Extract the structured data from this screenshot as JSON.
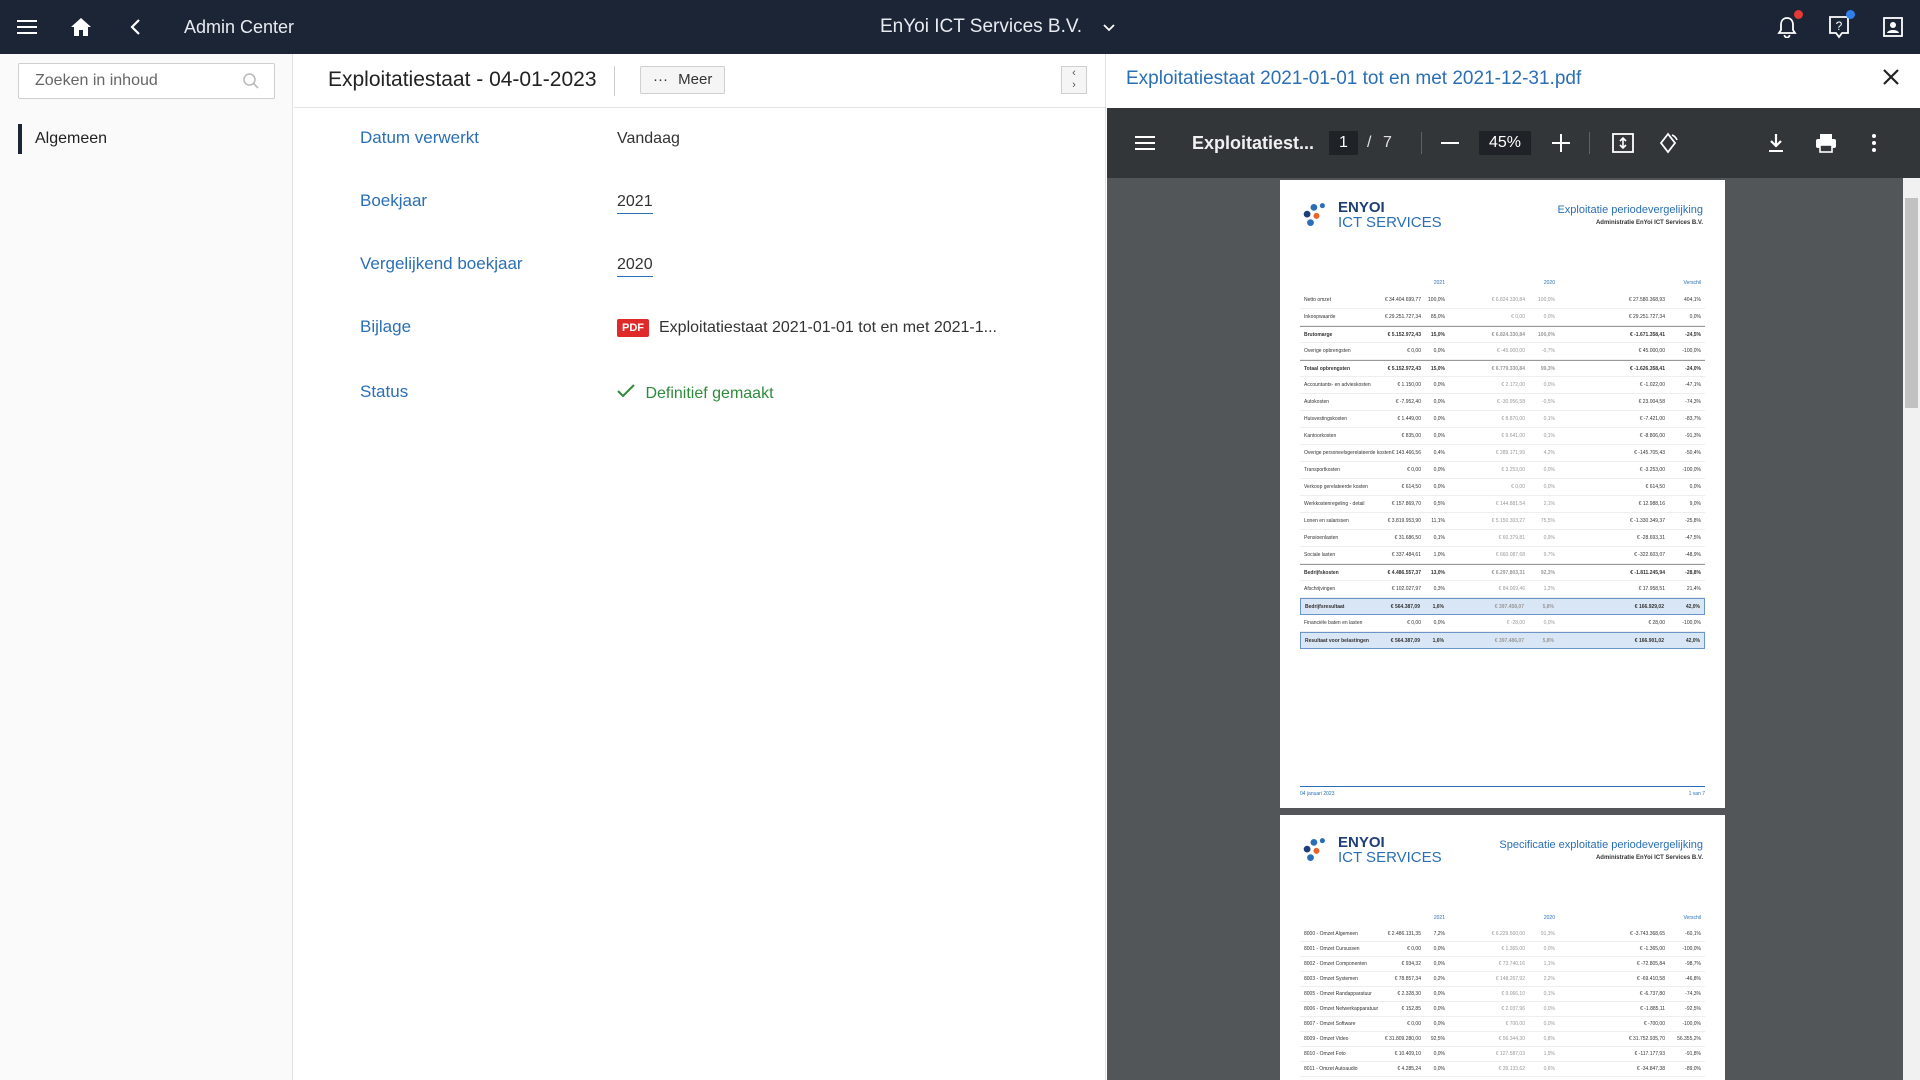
{
  "topbar": {
    "title": "Admin Center",
    "company": "EnYoi ICT Services B.V."
  },
  "sidebar": {
    "search_placeholder": "Zoeken in inhoud",
    "items": [
      {
        "label": "Algemeen"
      }
    ]
  },
  "detail": {
    "title": "Exploitatiestaat - 04-01-2023",
    "meer_label": "Meer",
    "fields": [
      {
        "label": "Datum verwerkt",
        "value": "Vandaag"
      },
      {
        "label": "Boekjaar",
        "value": "2021"
      },
      {
        "label": "Vergelijkend boekjaar",
        "value": "2020"
      },
      {
        "label": "Bijlage",
        "badge": "PDF",
        "value": "Exploitatiestaat 2021-01-01 tot en met 2021-1..."
      },
      {
        "label": "Status",
        "value": "Definitief gemaakt"
      }
    ]
  },
  "preview": {
    "title": "Exploitatiestaat 2021-01-01 tot en met 2021-12-31.pdf",
    "viewer": {
      "doc_title": "Exploitatiest...",
      "page_current": "1",
      "page_sep": "/",
      "page_total": "7",
      "zoom": "45%"
    },
    "page1": {
      "logo_line1": "ENYOI",
      "logo_line2": "ICT SERVICES",
      "heading": "Exploitatie periodevergelijking",
      "subheading": "Administratie EnYoi ICT Services B.V.",
      "col_headers": [
        "2021",
        "2020",
        "Verschil"
      ],
      "rows": [
        {
          "label": "Netto omzet",
          "v1": "€ 34.404.699,77",
          "p1": "100,0%",
          "v2": "€ 6.824.330,84",
          "p2": "100,0%",
          "v3": "€ 27.580.368,93",
          "p3": "404,1%",
          "style": ""
        },
        {
          "label": "Inkoopwaarde",
          "v1": "€ 29.251.727,34",
          "p1": "85,0%",
          "v2": "€ 0,00",
          "p2": "0,0%",
          "v3": "€ 29.251.727,34",
          "p3": "0,0%",
          "style": ""
        },
        {
          "label": "Brutomarge",
          "v1": "€ 5.152.972,43",
          "p1": "15,0%",
          "v2": "€ 6.824.330,84",
          "p2": "100,0%",
          "v3": "€ -1.671.358,41",
          "p3": "-24,5%",
          "style": "bold"
        },
        {
          "label": "Overige opbrengsten",
          "v1": "€ 0,00",
          "p1": "0,0%",
          "v2": "€ -45.000,00",
          "p2": "-0,7%",
          "v3": "€ 45.000,00",
          "p3": "-100,0%",
          "style": ""
        },
        {
          "label": "Totaal opbrengsten",
          "v1": "€ 5.152.972,43",
          "p1": "15,0%",
          "v2": "€ 6.779.330,84",
          "p2": "99,3%",
          "v3": "€ -1.626.358,41",
          "p3": "-24,0%",
          "style": "bold"
        },
        {
          "label": "Accountants- en advieskosten",
          "v1": "€ 1.150,00",
          "p1": "0,0%",
          "v2": "€ 2.172,00",
          "p2": "0,0%",
          "v3": "€ -1.022,00",
          "p3": "-47,1%",
          "style": ""
        },
        {
          "label": "Autokosten",
          "v1": "€ -7.952,40",
          "p1": "0,0%",
          "v2": "€ -30.956,58",
          "p2": "-0,5%",
          "v3": "€ 23.004,58",
          "p3": "-74,3%",
          "style": ""
        },
        {
          "label": "Huisvestingskosten",
          "v1": "€ 1.449,00",
          "p1": "0,0%",
          "v2": "€ 8.870,00",
          "p2": "0,1%",
          "v3": "€ -7.421,00",
          "p3": "-83,7%",
          "style": ""
        },
        {
          "label": "Kantoorkosten",
          "v1": "€ 835,00",
          "p1": "0,0%",
          "v2": "€ 9.641,00",
          "p2": "0,1%",
          "v3": "€ -8.806,00",
          "p3": "-91,3%",
          "style": ""
        },
        {
          "label": "Overige personeelsgerelateerde kosten",
          "v1": "€ 143.466,56",
          "p1": "0,4%",
          "v2": "€ 289.171,99",
          "p2": "4,2%",
          "v3": "€ -145.705,43",
          "p3": "-50,4%",
          "style": ""
        },
        {
          "label": "Transportkosten",
          "v1": "€ 0,00",
          "p1": "0,0%",
          "v2": "€ 3.253,00",
          "p2": "0,0%",
          "v3": "€ -3.253,00",
          "p3": "-100,0%",
          "style": ""
        },
        {
          "label": "Verkoop gerelateerde kosten",
          "v1": "€ 614,50",
          "p1": "0,0%",
          "v2": "€ 0,00",
          "p2": "0,0%",
          "v3": "€ 614,50",
          "p3": "0,0%",
          "style": ""
        },
        {
          "label": "Werkkostenregeling - detail",
          "v1": "€ 157.869,70",
          "p1": "0,5%",
          "v2": "€ 144.881,54",
          "p2": "2,1%",
          "v3": "€ 12.988,16",
          "p3": "9,0%",
          "style": ""
        },
        {
          "label": "Lonen en salarissen",
          "v1": "€ 3.819.953,90",
          "p1": "11,1%",
          "v2": "€ 5.150.303,27",
          "p2": "75,5%",
          "v3": "€ -1.330.349,37",
          "p3": "-25,8%",
          "style": ""
        },
        {
          "label": "Pensioenlasten",
          "v1": "€ 31.686,50",
          "p1": "0,1%",
          "v2": "€ 60.379,81",
          "p2": "0,9%",
          "v3": "€ -28.693,31",
          "p3": "-47,5%",
          "style": ""
        },
        {
          "label": "Sociale lasten",
          "v1": "€ 337.484,61",
          "p1": "1,0%",
          "v2": "€ 660.087,68",
          "p2": "9,7%",
          "v3": "€ -322.603,07",
          "p3": "-48,9%",
          "style": ""
        },
        {
          "label": "Bedrijfskosten",
          "v1": "€ 4.486.557,37",
          "p1": "13,0%",
          "v2": "€ 6.297.803,31",
          "p2": "92,3%",
          "v3": "€ -1.811.245,94",
          "p3": "-28,8%",
          "style": "bold"
        },
        {
          "label": "Afschrijvingen",
          "v1": "€ 102.027,97",
          "p1": "0,3%",
          "v2": "€ 84.069,46",
          "p2": "1,2%",
          "v3": "€ 17.958,51",
          "p3": "21,4%",
          "style": ""
        },
        {
          "label": "Bedrijfsresultaat",
          "v1": "€ 564.387,09",
          "p1": "1,6%",
          "v2": "€ 397.458,07",
          "p2": "5,8%",
          "v3": "€ 166.929,02",
          "p3": "42,0%",
          "style": "hl"
        },
        {
          "label": "Financiële baten en lasten",
          "v1": "€ 0,00",
          "p1": "0,0%",
          "v2": "€ -28,00",
          "p2": "0,0%",
          "v3": "€ 28,00",
          "p3": "-100,0%",
          "style": ""
        },
        {
          "label": "Resultaat voor belastingen",
          "v1": "€ 564.387,09",
          "p1": "1,6%",
          "v2": "€ 397.486,07",
          "p2": "5,8%",
          "v3": "€ 166.901,02",
          "p3": "42,0%",
          "style": "hl"
        }
      ],
      "footer_left": "04 januari 2023",
      "footer_right": "1 van 7"
    },
    "page2": {
      "logo_line1": "ENYOI",
      "logo_line2": "ICT SERVICES",
      "heading": "Specificatie exploitatie periodevergelijking",
      "subheading": "Administratie EnYoi ICT Services B.V.",
      "col_headers": [
        "2021",
        "2020",
        "Verschil"
      ],
      "rows": [
        {
          "label": "8000 - Omzet Algemeen",
          "v1": "€ 2.486.131,35",
          "p1": "7,2%",
          "v2": "€ 6.229.500,00",
          "p2": "91,3%",
          "v3": "€ -3.743.368,65",
          "p3": "-60,1%"
        },
        {
          "label": "8001 - Omzet Cursussen",
          "v1": "€ 0,00",
          "p1": "0,0%",
          "v2": "€ 1.365,00",
          "p2": "0,0%",
          "v3": "€ -1.365,00",
          "p3": "-100,0%"
        },
        {
          "label": "8002 - Omzet Componenten",
          "v1": "€ 934,32",
          "p1": "0,0%",
          "v2": "€ 73.740,16",
          "p2": "1,1%",
          "v3": "€ -72.805,84",
          "p3": "-98,7%"
        },
        {
          "label": "8003 - Omzet Systemen",
          "v1": "€ 78.857,34",
          "p1": "0,2%",
          "v2": "€ 148.267,92",
          "p2": "2,2%",
          "v3": "€ -69.410,58",
          "p3": "-46,8%"
        },
        {
          "label": "8005 - Omzet Randapparatuur",
          "v1": "€ 2.328,30",
          "p1": "0,0%",
          "v2": "€ 9.066,10",
          "p2": "0,1%",
          "v3": "€ -6.737,80",
          "p3": "-74,3%"
        },
        {
          "label": "8006 - Omzet Netwerkapparatuur",
          "v1": "€ 152,85",
          "p1": "0,0%",
          "v2": "€ 2.037,96",
          "p2": "0,0%",
          "v3": "€ -1.885,11",
          "p3": "-92,5%"
        },
        {
          "label": "8007 - Omzet Software",
          "v1": "€ 0,00",
          "p1": "0,0%",
          "v2": "€ 700,00",
          "p2": "0,0%",
          "v3": "€ -700,00",
          "p3": "-100,0%"
        },
        {
          "label": "8009 - Omzet Video",
          "v1": "€ 31.809.280,00",
          "p1": "92,5%",
          "v2": "€ 56.344,30",
          "p2": "0,8%",
          "v3": "€ 31.752.935,70",
          "p3": "56.355,2%"
        },
        {
          "label": "8010 - Omzet Foto",
          "v1": "€ 10.409,10",
          "p1": "0,0%",
          "v2": "€ 127.587,03",
          "p2": "1,9%",
          "v3": "€ -117.177,93",
          "p3": "-91,8%"
        },
        {
          "label": "8011 - Omzet Autoaudio",
          "v1": "€ 4.285,24",
          "p1": "0,0%",
          "v2": "€ 39.133,62",
          "p2": "0,6%",
          "v3": "€ -34.847,38",
          "p3": "-89,0%"
        }
      ]
    }
  }
}
